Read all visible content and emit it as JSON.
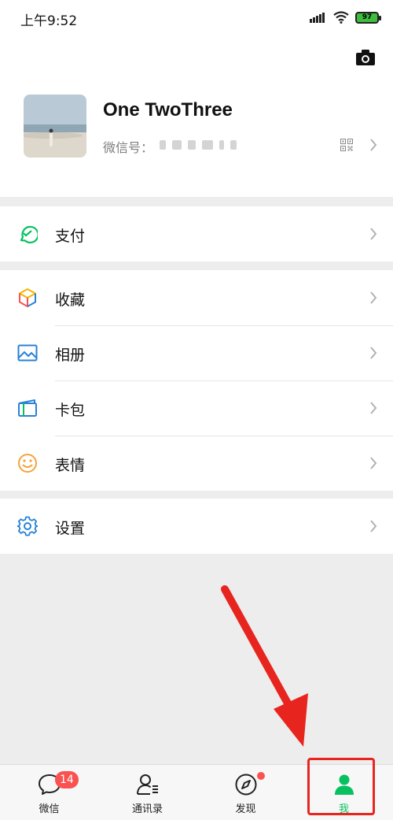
{
  "status_bar": {
    "time": "上午9:52",
    "battery_level": "97",
    "icons": [
      "signal-icon",
      "wifi-icon",
      "battery-icon"
    ]
  },
  "profile": {
    "name": "One TwoThree",
    "wechat_id_label": "微信号：",
    "icons": [
      "camera-icon",
      "qr-code-icon",
      "chevron-right-icon"
    ]
  },
  "menu": {
    "pay": {
      "label": "支付",
      "icon": "pay-icon",
      "color": "#07c160"
    },
    "favorites": {
      "label": "收藏",
      "icon": "favorites-cube-icon",
      "color": "#f4b400"
    },
    "album": {
      "label": "相册",
      "icon": "album-icon",
      "color": "#2782d7"
    },
    "cards": {
      "label": "卡包",
      "icon": "card-wallet-icon",
      "color": "#2782d7"
    },
    "stickers": {
      "label": "表情",
      "icon": "sticker-smile-icon",
      "color": "#f4a33b"
    },
    "settings": {
      "label": "设置",
      "icon": "settings-gear-icon",
      "color": "#2782d7"
    }
  },
  "tab_bar": {
    "tabs": [
      {
        "label": "微信",
        "icon": "chat-icon",
        "badge": "14"
      },
      {
        "label": "通讯录",
        "icon": "contacts-icon"
      },
      {
        "label": "发现",
        "icon": "discover-compass-icon",
        "has_dot": true
      },
      {
        "label": "我",
        "icon": "me-person-icon",
        "active": true
      }
    ],
    "active_color": "#07c160"
  },
  "annotation": {
    "highlight_color": "#e8241e"
  }
}
